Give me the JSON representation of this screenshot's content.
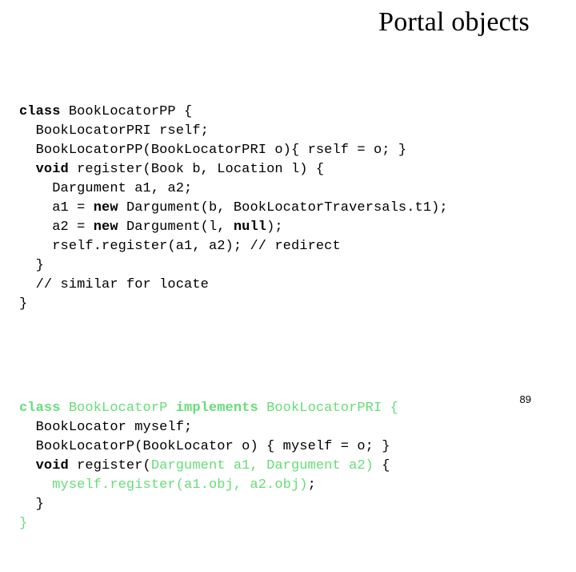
{
  "slide": {
    "title": "Portal objects",
    "page_number": "89",
    "accent_green": "#66dd77",
    "text_color": "#000000",
    "background": "#ffffff"
  },
  "code": {
    "block_a": [
      {
        "indent": "",
        "segments": [
          {
            "text": "class ",
            "style": "kw"
          },
          {
            "text": "BookLocatorPP {",
            "style": "plain"
          }
        ]
      },
      {
        "indent": "  ",
        "segments": [
          {
            "text": "BookLocatorPRI rself;",
            "style": "plain"
          }
        ]
      },
      {
        "indent": "  ",
        "segments": [
          {
            "text": "BookLocatorPP(BookLocatorPRI o){ rself = o; }",
            "style": "plain"
          }
        ]
      },
      {
        "indent": "  ",
        "segments": [
          {
            "text": "void ",
            "style": "kw"
          },
          {
            "text": "register(Book b, Location l) {",
            "style": "plain"
          }
        ]
      },
      {
        "indent": "    ",
        "segments": [
          {
            "text": "Dargument a1, a2;",
            "style": "plain"
          }
        ]
      },
      {
        "indent": "    ",
        "segments": [
          {
            "text": "a1 = ",
            "style": "plain"
          },
          {
            "text": "new ",
            "style": "kw"
          },
          {
            "text": "Dargument(b, BookLocatorTraversals.t1);",
            "style": "plain"
          }
        ]
      },
      {
        "indent": "    ",
        "segments": [
          {
            "text": "a2 = ",
            "style": "plain"
          },
          {
            "text": "new ",
            "style": "kw"
          },
          {
            "text": "Dargument(l, ",
            "style": "plain"
          },
          {
            "text": "null",
            "style": "kw"
          },
          {
            "text": ");",
            "style": "plain"
          }
        ]
      },
      {
        "indent": "    ",
        "segments": [
          {
            "text": "rself.register(a1, a2); // redirect",
            "style": "plain"
          }
        ]
      },
      {
        "indent": "  ",
        "segments": [
          {
            "text": "}",
            "style": "plain"
          }
        ]
      },
      {
        "indent": "  ",
        "segments": [
          {
            "text": "// similar for locate",
            "style": "plain"
          }
        ]
      },
      {
        "indent": "",
        "segments": [
          {
            "text": "}",
            "style": "plain"
          }
        ]
      }
    ],
    "block_b": [
      {
        "indent": "",
        "segments": [
          {
            "text": "class ",
            "style": "kw green"
          },
          {
            "text": "BookLocatorP ",
            "style": "green"
          },
          {
            "text": "implements ",
            "style": "kw green"
          },
          {
            "text": "BookLocatorPRI {",
            "style": "green"
          }
        ]
      },
      {
        "indent": "  ",
        "segments": [
          {
            "text": "BookLocator myself;",
            "style": "plain"
          }
        ]
      },
      {
        "indent": "  ",
        "segments": [
          {
            "text": "BookLocatorP(BookLocator o) { myself = o; }",
            "style": "plain"
          }
        ]
      },
      {
        "indent": "  ",
        "segments": [
          {
            "text": "void ",
            "style": "kw"
          },
          {
            "text": "register(",
            "style": "plain"
          },
          {
            "text": "Dargument a1, Dargument a2)",
            "style": "green"
          },
          {
            "text": " {",
            "style": "plain"
          }
        ]
      },
      {
        "indent": "    ",
        "segments": [
          {
            "text": "myself.register(a1.obj, a2.obj)",
            "style": "green"
          },
          {
            "text": ";",
            "style": "plain"
          }
        ]
      },
      {
        "indent": "  ",
        "segments": [
          {
            "text": "}",
            "style": "plain"
          }
        ]
      },
      {
        "indent": "",
        "segments": [
          {
            "text": "}",
            "style": "green"
          }
        ]
      }
    ]
  }
}
